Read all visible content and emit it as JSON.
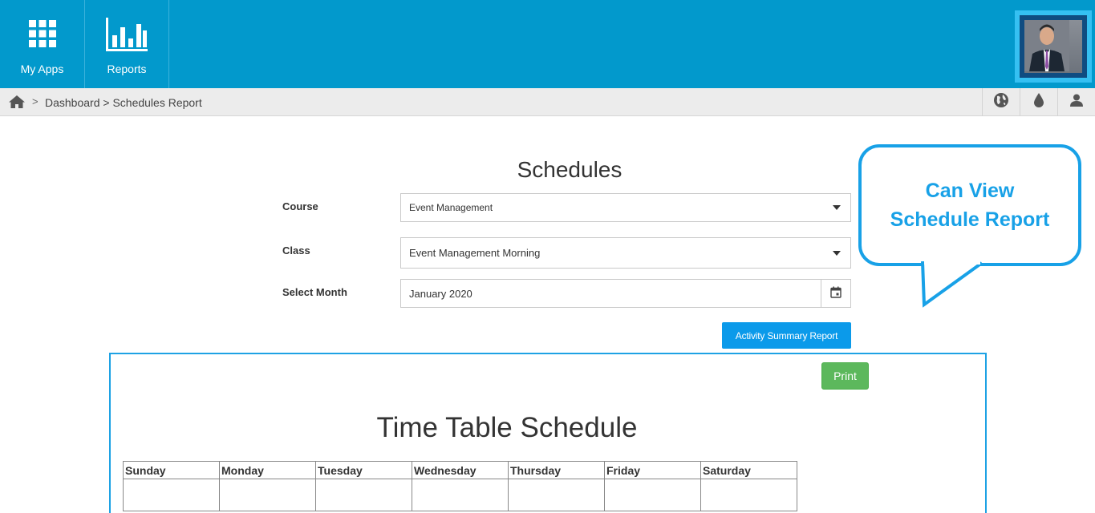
{
  "header": {
    "nav": [
      {
        "label": "My Apps",
        "icon": "grid-icon"
      },
      {
        "label": "Reports",
        "icon": "bar-chart-icon"
      }
    ],
    "profile_icon": "user-avatar"
  },
  "breadcrumb": {
    "separator": ">",
    "path": "Dashboard > Schedules Report",
    "right_icons": [
      "globe-icon",
      "drop-icon",
      "user-icon"
    ]
  },
  "page": {
    "title": "Schedules",
    "form": {
      "course_label": "Course",
      "course_value": "Event Management",
      "class_label": "Class",
      "class_value": "Event Management Morning",
      "month_label": "Select Month",
      "month_value": "January 2020"
    },
    "activity_button": "Activity Summary Report"
  },
  "callout": {
    "line1": "Can View",
    "line2": "Schedule Report"
  },
  "schedule": {
    "print_button": "Print",
    "title": "Time Table Schedule",
    "days": [
      "Sunday",
      "Monday",
      "Tuesday",
      "Wednesday",
      "Thursday",
      "Friday",
      "Saturday"
    ]
  },
  "colors": {
    "header_bg": "#0299cc",
    "accent": "#18a1e7",
    "button_blue": "#0b9aea",
    "print_green": "#5cb85c"
  }
}
